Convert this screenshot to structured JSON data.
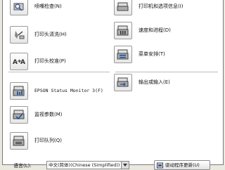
{
  "left_items": [
    {
      "label": "喷嘴检查(N)",
      "icon": "nozzle-check-icon"
    },
    {
      "label": "打印头清洗(H)",
      "icon": "head-cleaning-icon"
    },
    {
      "label": "打印头校准(P)",
      "icon": "print-head-alignment-icon"
    },
    {
      "label": "EPSON Status Monitor 3(F)",
      "icon": "status-monitor-icon"
    },
    {
      "label": "监视参数(M)",
      "icon": "monitoring-preferences-icon"
    },
    {
      "label": "打印队列(Q)",
      "icon": "print-queue-icon"
    }
  ],
  "right_items": [
    {
      "label": "打印机和选项信息(I)",
      "icon": "printer-info-icon"
    },
    {
      "label": "速度和进程(D)",
      "icon": "speed-progress-icon"
    },
    {
      "label": "菜单安排(T)",
      "icon": "menu-arrangement-icon"
    },
    {
      "label": "输出或输入(E)",
      "icon": "export-import-icon"
    }
  ],
  "footer": {
    "language_label": "语言(L):",
    "language_value": "中文(简体)(Chinese (Simplified))",
    "update_button_label": "驱动程序更新(U)"
  }
}
